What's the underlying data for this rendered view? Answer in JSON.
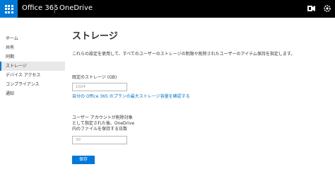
{
  "topbar": {
    "brand": "Office 365",
    "app": "OneDrive"
  },
  "sidebar": {
    "items": [
      {
        "label": "ホーム"
      },
      {
        "label": "共有"
      },
      {
        "label": "同期"
      },
      {
        "label": "ストレージ",
        "active": true
      },
      {
        "label": "デバイス アクセス"
      },
      {
        "label": "コンプライアンス"
      },
      {
        "label": "通知"
      }
    ]
  },
  "main": {
    "title": "ストレージ",
    "description": "これらの設定を使用して、すべてのユーザーのストレージの制限や削除されたユーザーのアイテム保持を指定します。",
    "storage": {
      "label": "既定のストレージ (GB)",
      "value": "1024",
      "link": "自分の Office 365 のプランの最大ストレージ容量を確認する"
    },
    "retention": {
      "label_lines": [
        "ユーザー アカウントが削除対象",
        "として指定された後、OneDrive",
        "内のファイルを保持する日数"
      ],
      "value": "30"
    },
    "save_label": "保存"
  }
}
